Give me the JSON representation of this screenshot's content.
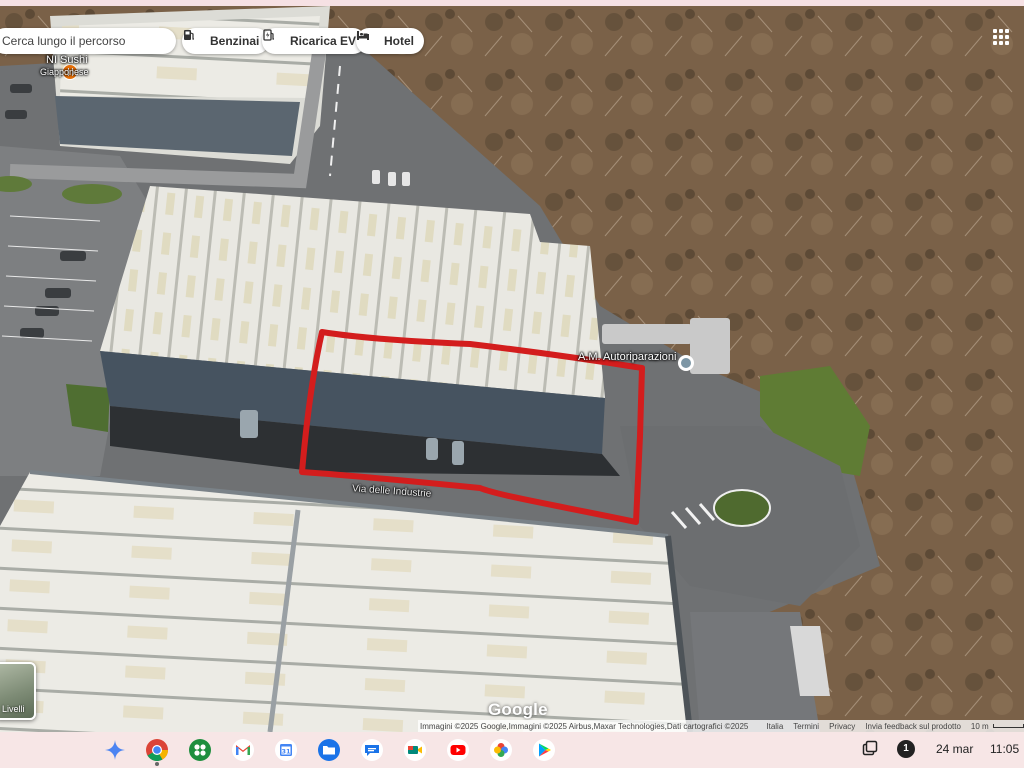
{
  "search": {
    "placeholder": "Cerca lungo il percorso"
  },
  "chips": [
    {
      "label": "Benzinai",
      "icon": "fuel-icon"
    },
    {
      "label": "Ricarica EV",
      "icon": "ev-charger-icon"
    },
    {
      "label": "Hotel",
      "icon": "bed-icon"
    }
  ],
  "places": {
    "sushi": {
      "name": "NI Sushi",
      "category": "Giapponese",
      "icon": "restaurant-icon",
      "color": "#e8710a"
    },
    "business": {
      "name": "A.M. Autoriparazioni",
      "icon": "place-icon",
      "color": "#7d96a5"
    }
  },
  "street": {
    "name": "Via delle Industrie"
  },
  "layers": {
    "label": "Livelli"
  },
  "logo": {
    "text": "Google"
  },
  "attribution": {
    "credits": "Immagini ©2025 Google,Immagini ©2025 Airbus,Maxar Technologies,Dati cartografici ©2025",
    "links": [
      "Italia",
      "Termini",
      "Privacy",
      "Invia feedback sul prodotto"
    ],
    "scale": "10 m"
  },
  "annotation": {
    "color": "#d31d1d"
  },
  "shelf": {
    "apps": [
      "gemini-icon",
      "chrome-icon",
      "apps-launcher-icon",
      "gmail-icon",
      "calendar-icon",
      "files-icon",
      "messages-icon",
      "meet-icon",
      "youtube-icon",
      "photos-icon",
      "play-store-icon"
    ],
    "notification_count": "1",
    "date": "24 mar",
    "time": "11:05"
  }
}
